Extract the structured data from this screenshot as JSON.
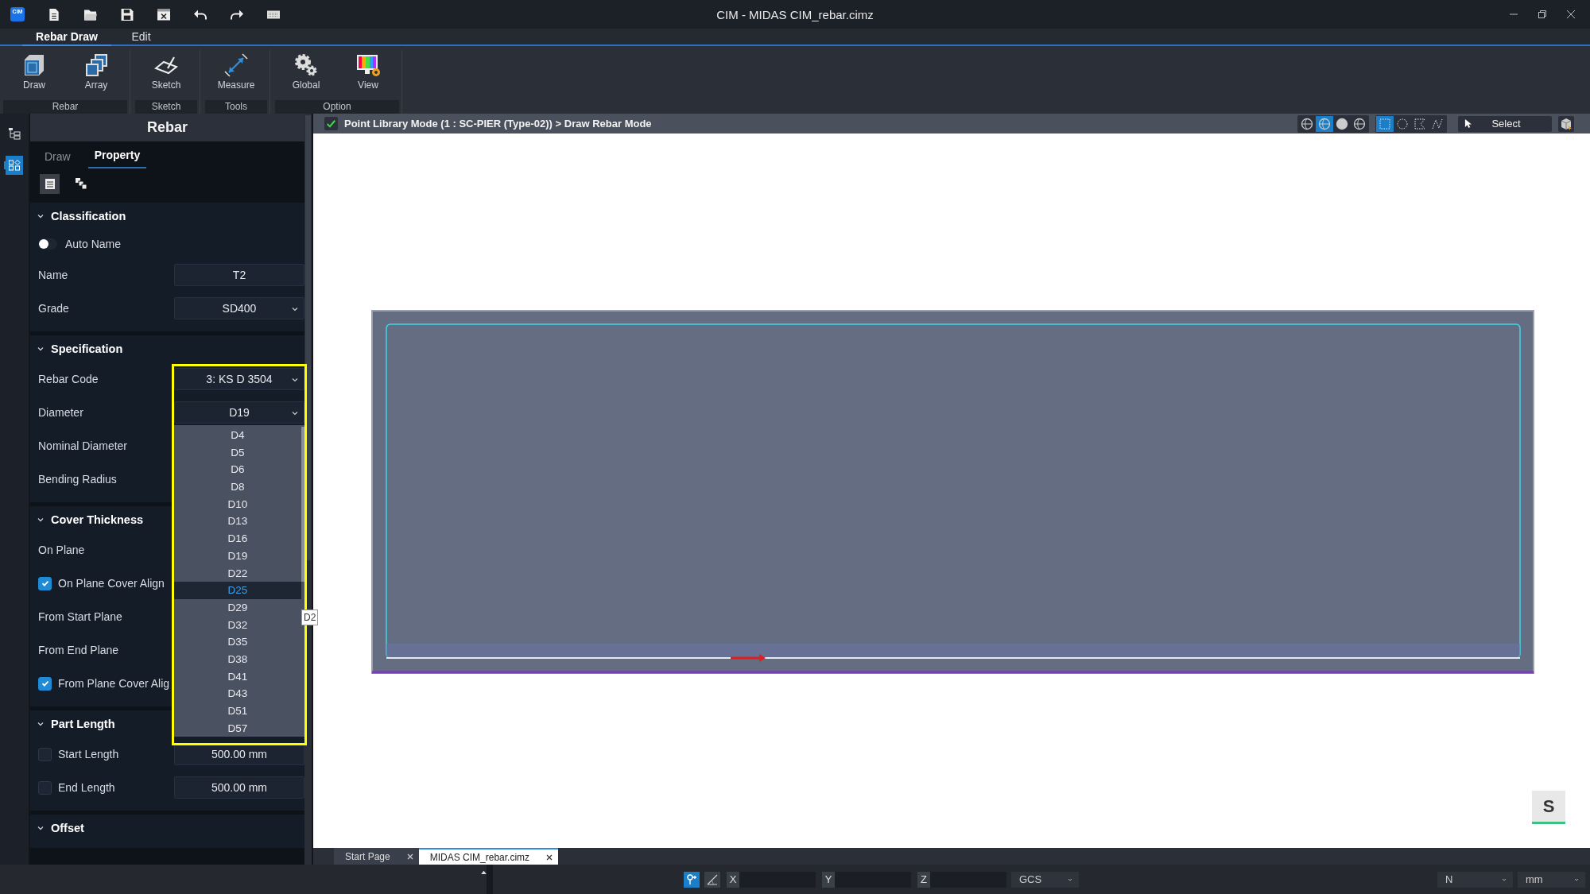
{
  "window": {
    "title": "CIM - MIDAS CIM_rebar.cimz",
    "logo_text": "CIM"
  },
  "ribbon_tabs": [
    {
      "label": "Rebar Draw",
      "selected": true
    },
    {
      "label": "Edit",
      "selected": false
    }
  ],
  "ribbon_groups": [
    {
      "label": "Rebar",
      "buttons": [
        "Draw",
        "Array"
      ]
    },
    {
      "label": "Sketch",
      "buttons": [
        "Sketch"
      ]
    },
    {
      "label": "Tools",
      "buttons": [
        "Measure"
      ]
    },
    {
      "label": "Option",
      "buttons": [
        "Global",
        "View"
      ]
    }
  ],
  "side_icons": [
    {
      "selected": false
    },
    {
      "selected": true
    }
  ],
  "panel": {
    "title": "Rebar",
    "tabs": [
      {
        "label": "Draw",
        "selected": false
      },
      {
        "label": "Property",
        "selected": true
      }
    ],
    "tool_buttons": [
      {
        "selected": true
      },
      {
        "selected": false
      }
    ],
    "sections": [
      {
        "title": "Classification",
        "expanded": true,
        "rows": [
          {
            "kind": "toggle",
            "label": "Auto Name",
            "on": false
          },
          {
            "kind": "field",
            "label": "Name",
            "value": "T2"
          },
          {
            "kind": "select",
            "label": "Grade",
            "value": "SD400"
          }
        ]
      },
      {
        "title": "Specification",
        "expanded": true,
        "rows": [
          {
            "kind": "select",
            "label": "Rebar Code",
            "value": "3: KS D 3504",
            "highlighted": true
          },
          {
            "kind": "select",
            "label": "Diameter",
            "value": "D19",
            "open": true
          },
          {
            "kind": "label",
            "label": "Nominal Diameter"
          },
          {
            "kind": "label",
            "label": "Bending Radius"
          }
        ]
      },
      {
        "title": "Cover Thickness",
        "expanded": true,
        "rows": [
          {
            "kind": "label",
            "label": "On Plane"
          },
          {
            "kind": "check",
            "label": "On Plane Cover Align",
            "checked": true
          },
          {
            "kind": "label",
            "label": "From Start Plane"
          },
          {
            "kind": "label",
            "label": "From End Plane"
          },
          {
            "kind": "check",
            "label": "From Plane Cover Alig",
            "checked": true
          }
        ]
      },
      {
        "title": "Part Length",
        "expanded": true,
        "rows": [
          {
            "kind": "check_field",
            "label": "Start Length",
            "checked": false,
            "value": "500.00 mm"
          },
          {
            "kind": "check_field",
            "label": "End Length",
            "checked": false,
            "value": "500.00 mm"
          }
        ]
      },
      {
        "title": "Offset",
        "expanded": true
      }
    ]
  },
  "dropdown": {
    "items": [
      {
        "label": "D4",
        "selected": false
      },
      {
        "label": "D5",
        "selected": false
      },
      {
        "label": "D6",
        "selected": false
      },
      {
        "label": "D8",
        "selected": false
      },
      {
        "label": "D10",
        "selected": false
      },
      {
        "label": "D13",
        "selected": false
      },
      {
        "label": "D16",
        "selected": false
      },
      {
        "label": "D19",
        "selected": false
      },
      {
        "label": "D22",
        "selected": false
      },
      {
        "label": "D25",
        "selected": true
      },
      {
        "label": "D29",
        "selected": false
      },
      {
        "label": "D32",
        "selected": false
      },
      {
        "label": "D35",
        "selected": false
      },
      {
        "label": "D38",
        "selected": false
      },
      {
        "label": "D41",
        "selected": false
      },
      {
        "label": "D43",
        "selected": false
      },
      {
        "label": "D51",
        "selected": false
      },
      {
        "label": "D57",
        "selected": false
      }
    ],
    "tooltip": "D2"
  },
  "viewport": {
    "mode_text": "Point Library Mode (1 : SC-PIER (Type-02)) > Draw Rebar Mode",
    "view_buttons": [
      {
        "selected": false
      },
      {
        "selected": true
      },
      {
        "selected": false
      },
      {
        "selected": false
      }
    ],
    "selection_shapes": [
      {
        "selected": true
      },
      {
        "selected": false
      },
      {
        "selected": false
      },
      {
        "selected": false
      }
    ],
    "select_label": "Select",
    "snap_badge": "S"
  },
  "doc_tabs": [
    {
      "label": "Start Page",
      "selected": false
    },
    {
      "label": "MIDAS CIM_rebar.cimz",
      "selected": true
    }
  ],
  "status_bar": {
    "tools": [
      {
        "selected": true
      },
      {
        "selected": false
      }
    ],
    "coords": [
      "X",
      "Y",
      "Z"
    ],
    "system": "GCS",
    "force_unit": "N",
    "length_unit": "mm"
  }
}
